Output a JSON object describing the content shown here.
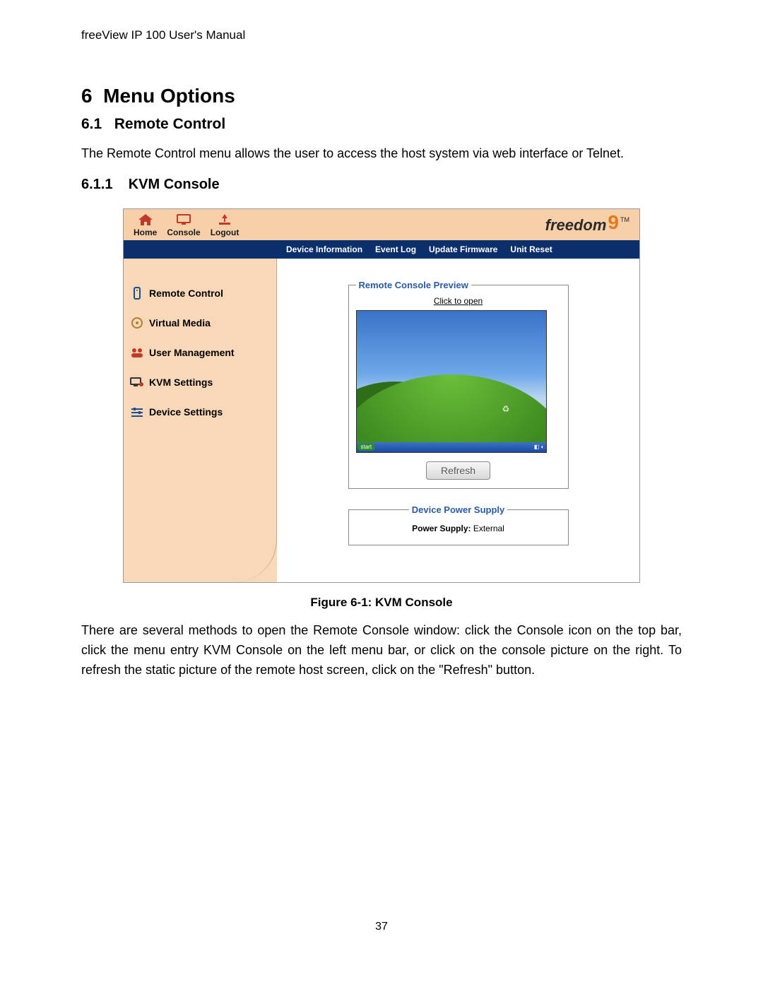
{
  "doc": {
    "header": "freeView IP 100 User's Manual",
    "chapter_num": "6",
    "chapter_title": "Menu Options",
    "section_num": "6.1",
    "section_title": "Remote Control",
    "section_text": "The Remote Control menu allows the user to access the host system via web interface or Telnet.",
    "subsection_num": "6.1.1",
    "subsection_title": "KVM Console",
    "figure_caption": "Figure 6-1: KVM Console",
    "body2": "There are several methods to open the Remote Console window: click the Console icon on the top bar, click the menu entry KVM Console on the left menu bar, or click on the console picture on the right. To refresh the static picture of the remote host screen, click on the \"Refresh\" button.",
    "page_number": "37"
  },
  "ui": {
    "topbar": {
      "home": "Home",
      "console": "Console",
      "logout": "Logout",
      "brand": "freedom",
      "brand_nine": "9",
      "tm": "TM"
    },
    "navstrip": {
      "devinfo": "Device Information",
      "eventlog": "Event Log",
      "update": "Update Firmware",
      "reset": "Unit Reset"
    },
    "sidebar": {
      "remote": "Remote Control",
      "virtual": "Virtual Media",
      "user": "User Management",
      "kvm": "KVM Settings",
      "device": "Device Settings"
    },
    "preview": {
      "legend": "Remote Console Preview",
      "click": "Click to open",
      "start": "start",
      "refresh": "Refresh"
    },
    "power": {
      "legend": "Device Power Supply",
      "label": "Power Supply:",
      "value": "External"
    }
  }
}
